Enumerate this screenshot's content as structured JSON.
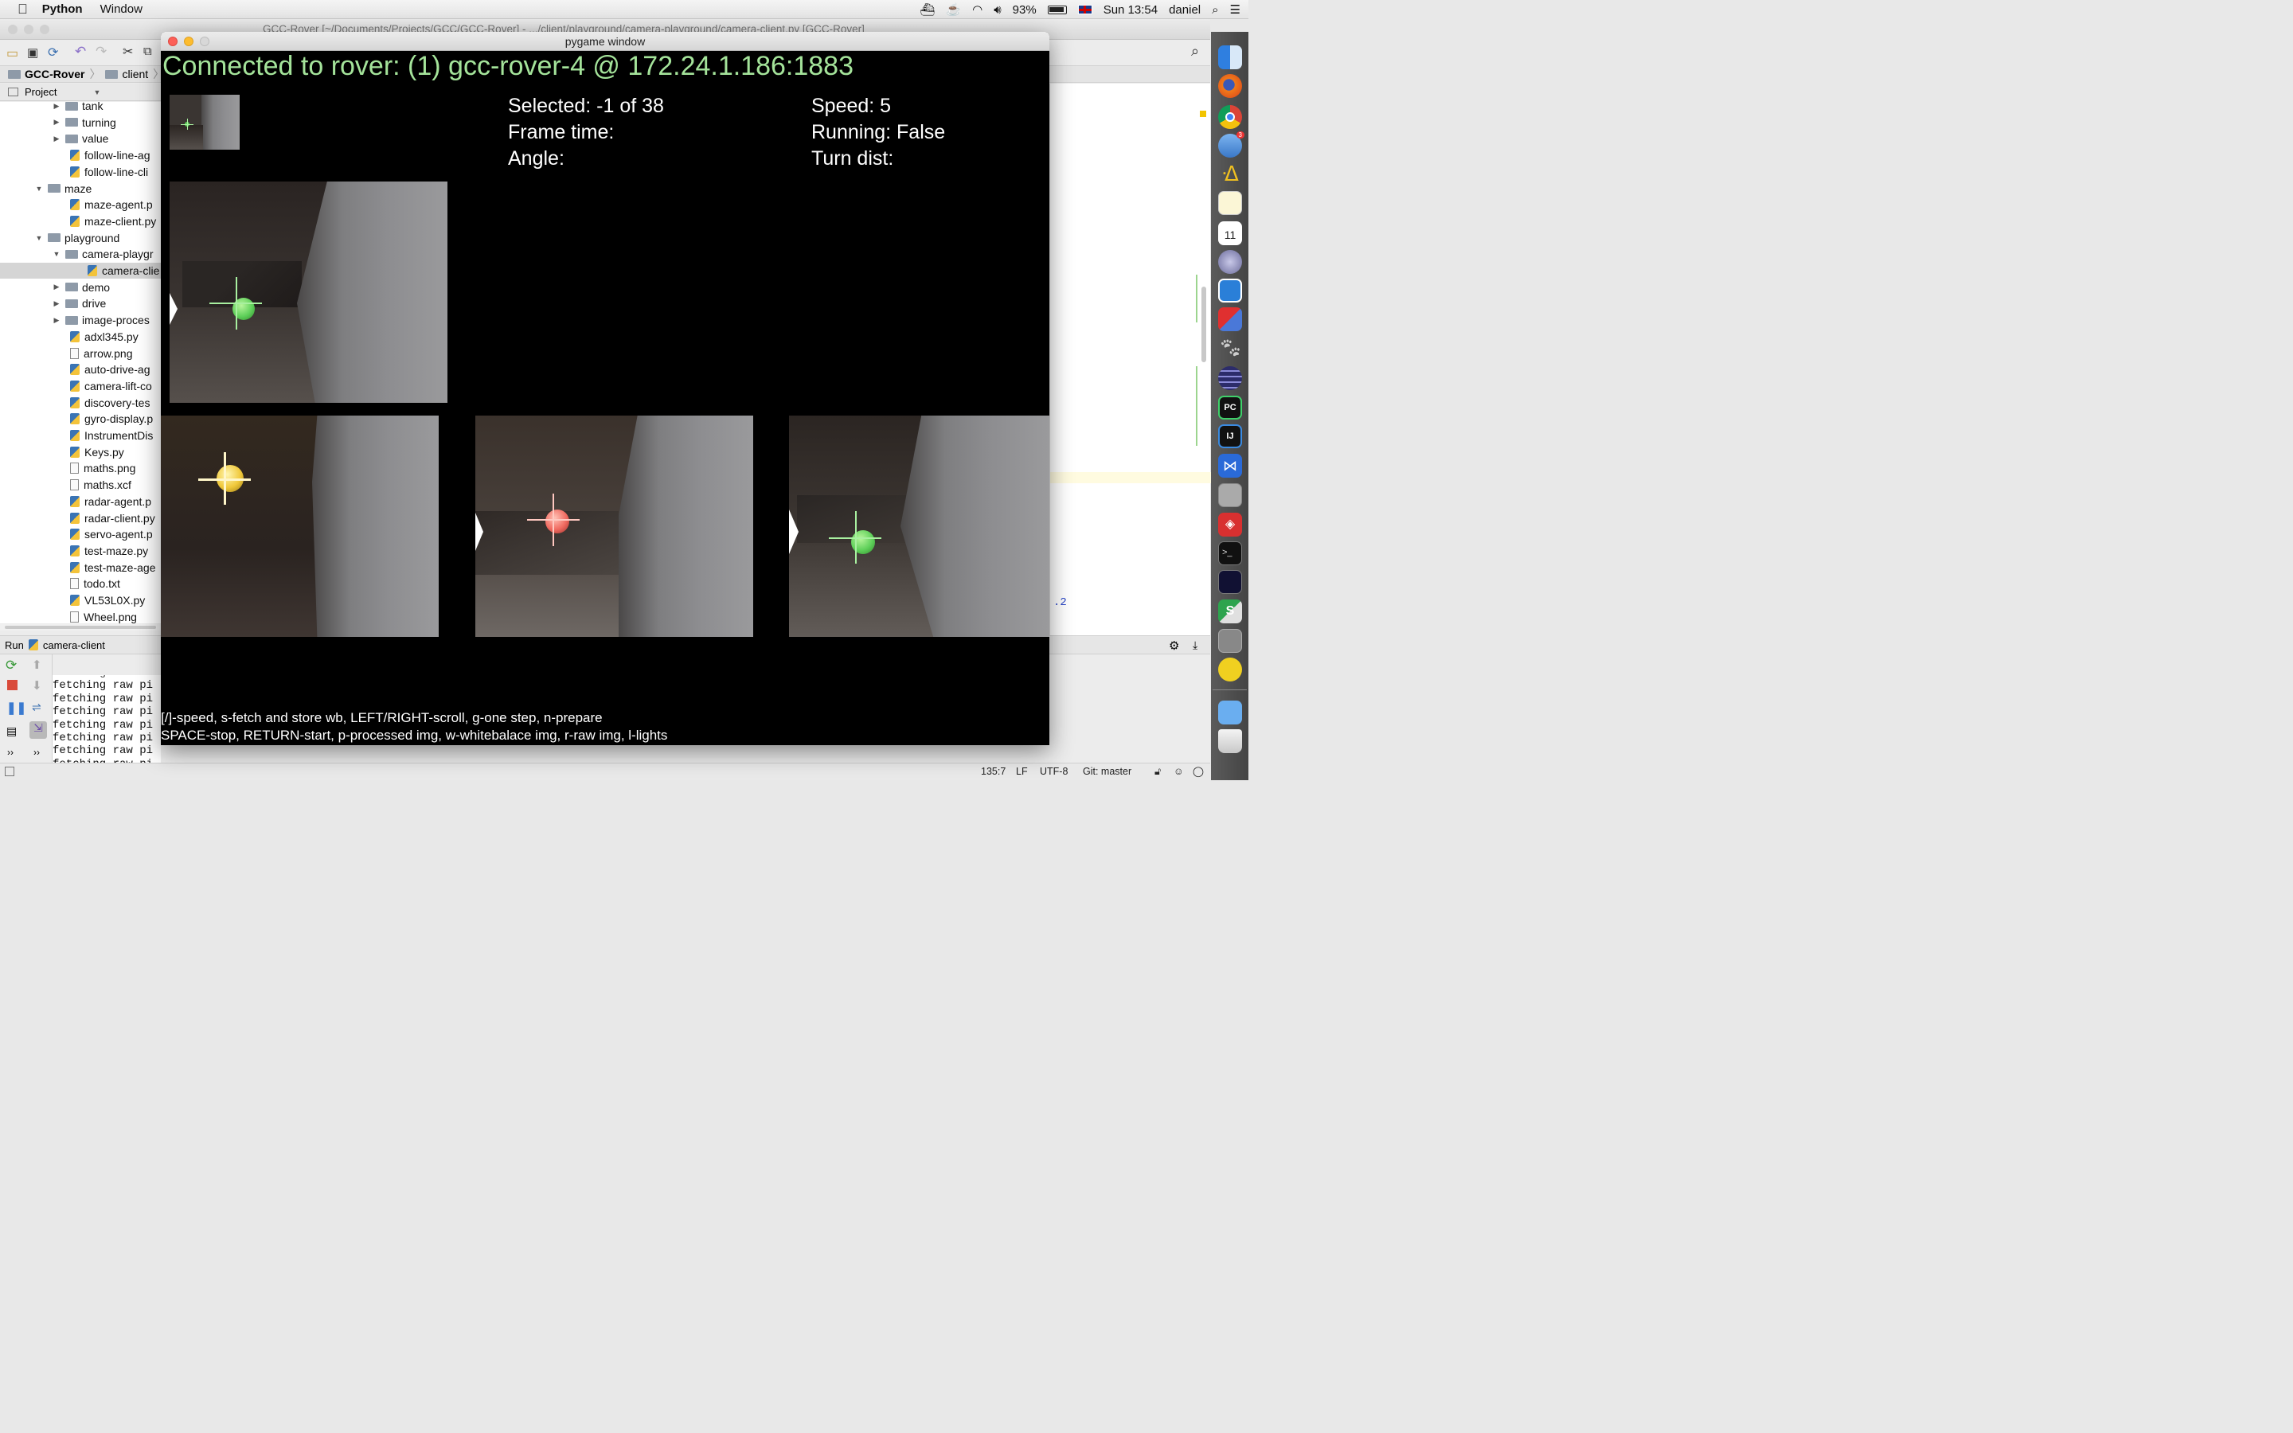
{
  "menubar": {
    "apple": "",
    "app_name": "Python",
    "window_menu": "Window",
    "battery": "93%",
    "clock": "Sun 13:54",
    "user": "daniel"
  },
  "ide": {
    "title": "GCC-Rover [~/Documents/Projects/GCC/GCC-Rover] - .../client/playground/camera-playground/camera-client.py [GCC-Rover]",
    "breadcrumb": [
      "GCC-Rover",
      "client"
    ],
    "project_tab": "Project",
    "tree": [
      {
        "label": "tank",
        "kind": "folder",
        "indent": 1,
        "arrow": "▶"
      },
      {
        "label": "turning",
        "kind": "folder",
        "indent": 1,
        "arrow": "▶"
      },
      {
        "label": "value",
        "kind": "folder",
        "indent": 1,
        "arrow": "▶"
      },
      {
        "label": "follow-line-ag",
        "kind": "py",
        "indent": 2,
        "arrow": ""
      },
      {
        "label": "follow-line-cli",
        "kind": "py",
        "indent": 2,
        "arrow": ""
      },
      {
        "label": "maze",
        "kind": "folder",
        "indent": 0,
        "arrow": "▼"
      },
      {
        "label": "maze-agent.p",
        "kind": "py",
        "indent": 2,
        "arrow": ""
      },
      {
        "label": "maze-client.py",
        "kind": "py",
        "indent": 2,
        "arrow": ""
      },
      {
        "label": "playground",
        "kind": "folder",
        "indent": 0,
        "arrow": "▼"
      },
      {
        "label": "camera-playgr",
        "kind": "folder",
        "indent": 1,
        "arrow": "▼"
      },
      {
        "label": "camera-clie",
        "kind": "py",
        "indent": 3,
        "arrow": ""
      },
      {
        "label": "demo",
        "kind": "folder",
        "indent": 1,
        "arrow": "▶"
      },
      {
        "label": "drive",
        "kind": "folder",
        "indent": 1,
        "arrow": "▶"
      },
      {
        "label": "image-proces",
        "kind": "folder",
        "indent": 1,
        "arrow": "▶"
      },
      {
        "label": "adxl345.py",
        "kind": "py",
        "indent": 2,
        "arrow": ""
      },
      {
        "label": "arrow.png",
        "kind": "txt",
        "indent": 2,
        "arrow": ""
      },
      {
        "label": "auto-drive-ag",
        "kind": "py",
        "indent": 2,
        "arrow": ""
      },
      {
        "label": "camera-lift-co",
        "kind": "py",
        "indent": 2,
        "arrow": ""
      },
      {
        "label": "discovery-tes",
        "kind": "py",
        "indent": 2,
        "arrow": ""
      },
      {
        "label": "gyro-display.p",
        "kind": "py",
        "indent": 2,
        "arrow": ""
      },
      {
        "label": "InstrumentDis",
        "kind": "py",
        "indent": 2,
        "arrow": ""
      },
      {
        "label": "Keys.py",
        "kind": "py",
        "indent": 2,
        "arrow": ""
      },
      {
        "label": "maths.png",
        "kind": "txt",
        "indent": 2,
        "arrow": ""
      },
      {
        "label": "maths.xcf",
        "kind": "txt",
        "indent": 2,
        "arrow": ""
      },
      {
        "label": "radar-agent.p",
        "kind": "py",
        "indent": 2,
        "arrow": ""
      },
      {
        "label": "radar-client.py",
        "kind": "py",
        "indent": 2,
        "arrow": ""
      },
      {
        "label": "servo-agent.p",
        "kind": "py",
        "indent": 2,
        "arrow": ""
      },
      {
        "label": "test-maze.py",
        "kind": "py",
        "indent": 2,
        "arrow": ""
      },
      {
        "label": "test-maze-age",
        "kind": "py",
        "indent": 2,
        "arrow": ""
      },
      {
        "label": "todo.txt",
        "kind": "txt",
        "indent": 2,
        "arrow": ""
      },
      {
        "label": "VL53L0X.py",
        "kind": "py",
        "indent": 2,
        "arrow": ""
      },
      {
        "label": "Wheel.png",
        "kind": "txt",
        "indent": 2,
        "arrow": ""
      }
    ],
    "run_label": "Run",
    "run_config": "camera-client",
    "console_lines": [
      "fetching raw pi",
      "fetching raw pi",
      "fetching raw pi",
      "fetching raw pi",
      "fetching raw pi",
      "fetching raw pi",
      "fetching raw pi",
      "fetching raw pictur"
    ],
    "editor_fragment": ".2",
    "status": {
      "position": "135:7",
      "line_sep": "LF",
      "encoding": "UTF-8",
      "vcs": "Git: master"
    }
  },
  "pygame": {
    "title": "pygame window",
    "connected": "Connected to rover: (1) gcc-rover-4 @ 172.24.1.186:1883",
    "selected": "Selected: -1 of 38",
    "frame_time": "Frame time:",
    "angle": "Angle:",
    "speed": "Speed: 5",
    "running": "Running: False",
    "turn_dist": "Turn dist:",
    "help1": "[/]-speed, s-fetch and store wb, LEFT/RIGHT-scroll, g-one step, n-prepare",
    "help2": "SPACE-stop, RETURN-start, p-processed img, w-whitebalace img, r-raw img, l-lights",
    "colors": {
      "connected_text": "#a4e39a",
      "background": "#000000"
    },
    "ball_colors": [
      "#5fd05a",
      "#f0c83a",
      "#f06a60",
      "#5fd05a"
    ]
  },
  "dock": {
    "badge": "3",
    "calendar_day": "11"
  }
}
